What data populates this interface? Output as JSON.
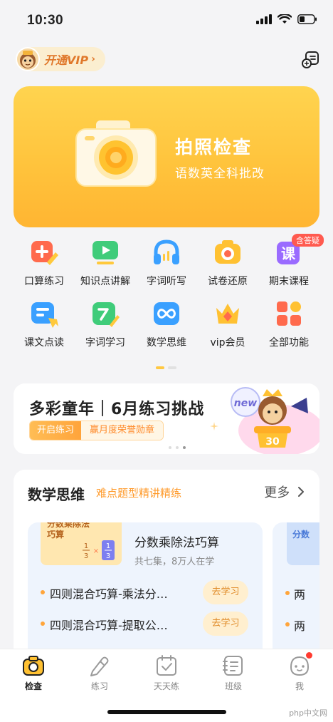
{
  "status": {
    "time": "10:30"
  },
  "vip": {
    "label": "开通VIP",
    "arrow": "›"
  },
  "hero": {
    "title": "拍照检查",
    "subtitle": "语数英全科批改"
  },
  "grid": {
    "row1": [
      {
        "label": "口算练习"
      },
      {
        "label": "知识点讲解"
      },
      {
        "label": "字词听写"
      },
      {
        "label": "试卷还原"
      },
      {
        "label": "期末课程",
        "badge": "含答疑",
        "glyph": "课"
      }
    ],
    "row2": [
      {
        "label": "课文点读"
      },
      {
        "label": "字词学习"
      },
      {
        "label": "数学思维"
      },
      {
        "label": "vip会员"
      },
      {
        "label": "全部功能"
      }
    ]
  },
  "banner": {
    "title": "多彩童年｜6月练习挑战",
    "pill_left": "开启练习",
    "pill_right": "赢月度荣誉勋章",
    "new_tag": "new",
    "medal_number": "30"
  },
  "math_card": {
    "title": "数学思维",
    "subtitle": "难点题型精讲精练",
    "more": "更多",
    "course": {
      "thumb_text": "分数乘除法巧算",
      "frac1_num": "1",
      "frac1_den": "3",
      "frac2_num": "1",
      "frac2_den": "3",
      "title": "分数乘除法巧算",
      "meta": "共七集，8万人在学",
      "lessons": [
        {
          "text": "四则混合巧算-乘法分…",
          "action": "去学习"
        },
        {
          "text": "四则混合巧算-提取公…",
          "action": "去学习"
        }
      ]
    },
    "course2": {
      "thumb_text": "分数",
      "lesson_prefixes": [
        "两",
        "两"
      ]
    }
  },
  "tabbar": {
    "tabs": [
      {
        "label": "检查"
      },
      {
        "label": "练习"
      },
      {
        "label": "天天练"
      },
      {
        "label": "班级"
      },
      {
        "label": "我"
      }
    ]
  },
  "watermark": "php中文网",
  "colors": {
    "accent": "#ffc23b",
    "orange": "#ff9a2a",
    "red": "#ff3b30"
  }
}
